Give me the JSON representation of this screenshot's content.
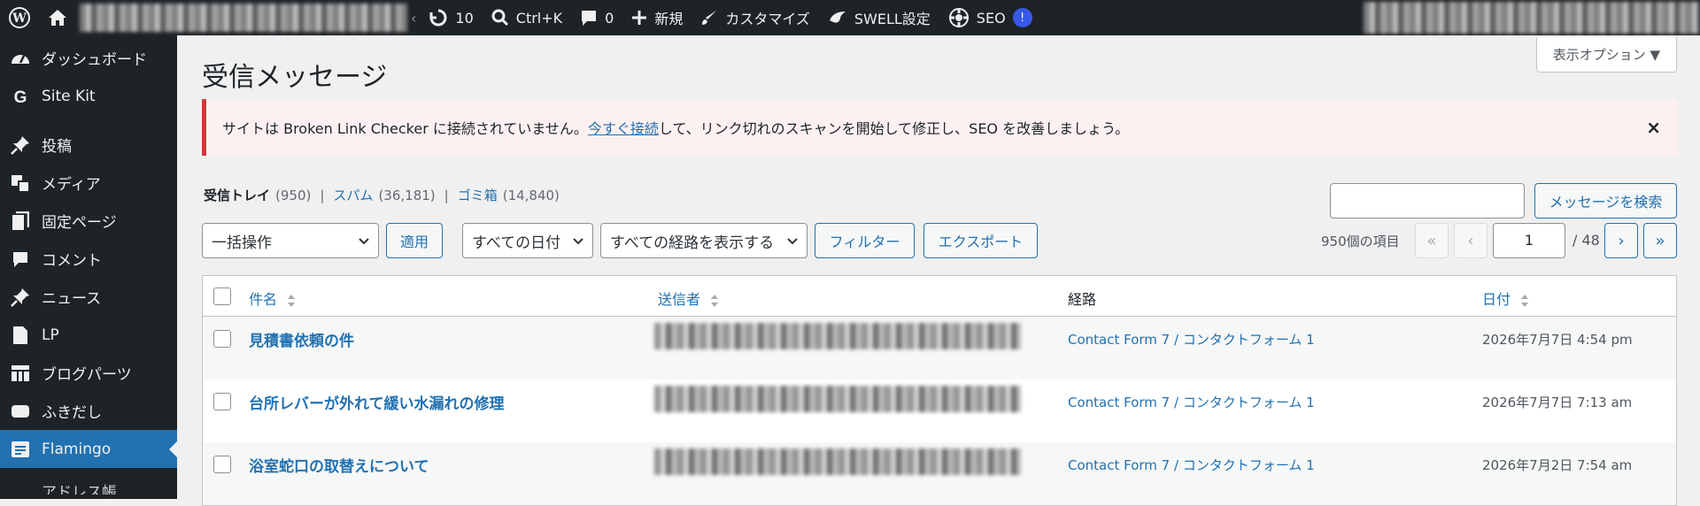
{
  "adminbar": {
    "updates_count": "10",
    "shortcut": "Ctrl+K",
    "comments_count": "0",
    "new_label": "新規",
    "customize_label": "カスタマイズ",
    "swell_label": "SWELL設定",
    "seo_label": "SEO",
    "seo_badge": "!"
  },
  "sidebar": {
    "items": [
      {
        "label": "ダッシュボード",
        "icon": "dashboard-icon"
      },
      {
        "label": "Site Kit",
        "icon": "google-g-icon"
      },
      {
        "label": "投稿",
        "icon": "pushpin-icon"
      },
      {
        "label": "メディア",
        "icon": "media-icon"
      },
      {
        "label": "固定ページ",
        "icon": "pages-icon"
      },
      {
        "label": "コメント",
        "icon": "comment-icon"
      },
      {
        "label": "ニュース",
        "icon": "pushpin-icon"
      },
      {
        "label": "LP",
        "icon": "document-icon"
      },
      {
        "label": "ブログパーツ",
        "icon": "grid-icon"
      },
      {
        "label": "ふきだし",
        "icon": "speech-bubble-icon"
      },
      {
        "label": "Flamingo",
        "icon": "flamingo-icon"
      },
      {
        "label": "アドレス帳",
        "icon": "address-book-icon"
      }
    ]
  },
  "screen_options": "表示オプション ▼",
  "page_title": "受信メッセージ",
  "notice": {
    "text_before": "サイトは Broken Link Checker に接続されていません。",
    "link": "今すぐ接続",
    "text_after": "して、リンク切れのスキャンを開始して修正し、SEO を改善しましょう。",
    "close": "×"
  },
  "views": {
    "inbox_label": "受信トレイ",
    "inbox_count": "(950)",
    "spam_label": "スパム",
    "spam_count": "(36,181)",
    "trash_label": "ゴミ箱",
    "trash_count": "(14,840)",
    "separator": "|"
  },
  "search": {
    "placeholder": "",
    "button": "メッセージを検索"
  },
  "filters": {
    "bulk_action": "一括操作",
    "apply": "適用",
    "dates": "すべての日付",
    "channels": "すべての経路を表示する",
    "filter": "フィルター",
    "export": "エクスポート"
  },
  "pagination": {
    "items": "950個の項目",
    "first": "«",
    "prev": "‹",
    "current": "1",
    "total": "/ 48",
    "next": "›",
    "last": "»"
  },
  "table": {
    "columns": {
      "subject": "件名",
      "from": "送信者",
      "channel": "経路",
      "date": "日付"
    },
    "rows": [
      {
        "subject": "見積書依頼の件",
        "channel": "Contact Form 7 / コンタクトフォーム 1",
        "date": "2026年7月7日 4:54 pm"
      },
      {
        "subject": "台所レバーが外れて緩い水漏れの修理",
        "channel": "Contact Form 7 / コンタクトフォーム 1",
        "date": "2026年7月7日 7:13 am"
      },
      {
        "subject": "浴室蛇口の取替えについて",
        "channel": "Contact Form 7 / コンタクトフォーム 1",
        "date": "2026年7月2日 7:54 am"
      }
    ]
  },
  "colors": {
    "adminbar_bg": "#1d2327",
    "accent": "#2271b1",
    "notice_border": "#d63638",
    "notice_bg": "#fcf0f1"
  }
}
